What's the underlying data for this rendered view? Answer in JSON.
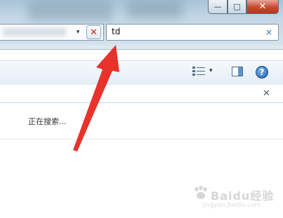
{
  "window": {
    "minimize_glyph": "—",
    "maximize_glyph": "□",
    "close_glyph": "✕"
  },
  "address_bar": {
    "dropdown_glyph": "▾",
    "stop_glyph": "✕"
  },
  "search": {
    "value": "td",
    "clear_glyph": "×"
  },
  "toolbar": {
    "view_menu_glyph": "▾",
    "help_glyph": "?"
  },
  "info_bar": {
    "close_glyph": "✕"
  },
  "content": {
    "status_text": "正在搜索..."
  },
  "annotation": {
    "arrow_color": "#e8322b"
  },
  "watermark": {
    "text": "Baidu经验",
    "url": "jingyan.baidu.com"
  }
}
